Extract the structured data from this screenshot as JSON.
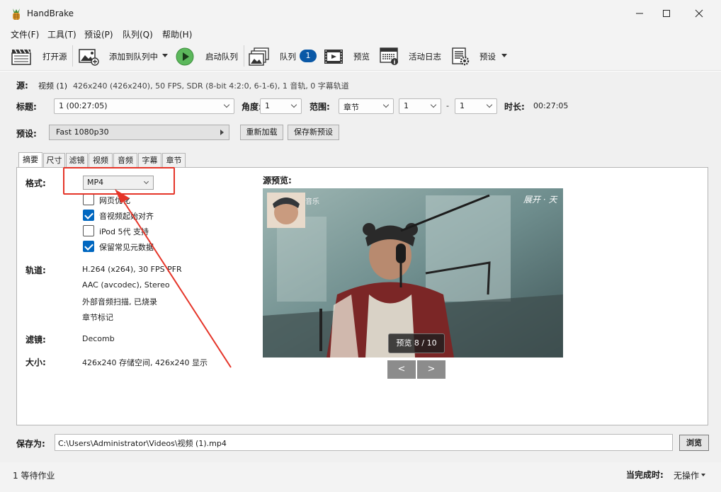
{
  "window": {
    "title": "HandBrake",
    "controls": {
      "minimize": "minimize-icon",
      "maximize": "maximize-icon",
      "close": "close-icon"
    }
  },
  "menu": [
    "文件(F)",
    "工具(T)",
    "预设(P)",
    "队列(Q)",
    "帮助(H)"
  ],
  "toolbar": {
    "open_source": "打开源",
    "add_to_queue": "添加到队列中",
    "start_queue": "启动队列",
    "queue": "队列",
    "queue_count": "1",
    "preview": "预览",
    "activity_log": "活动日志",
    "presets": "预设"
  },
  "source": {
    "label": "源:",
    "name": "视频 (1)",
    "info": "426x240 (426x240), 50 FPS, SDR (8-bit 4:2:0, 6-1-6), 1 音轨, 0 字幕轨道"
  },
  "title_row": {
    "title_label": "标题:",
    "title_value": "1  (00:27:05)",
    "angle_label": "角度:",
    "angle_value": "1",
    "range_label": "范围:",
    "range_type": "章节",
    "range_start": "1",
    "range_dash": "-",
    "range_end": "1",
    "duration_label": "时长:",
    "duration_value": "00:27:05"
  },
  "preset_row": {
    "label": "预设:",
    "value": "Fast 1080p30",
    "reload": "重新加载",
    "save_new": "保存新预设"
  },
  "tabs": [
    "摘要",
    "尺寸",
    "滤镜",
    "视频",
    "音频",
    "字幕",
    "章节"
  ],
  "summary": {
    "format_label": "格式:",
    "format_value": "MP4",
    "options": [
      {
        "label": "网页优化",
        "checked": false
      },
      {
        "label": "音视频起始对齐",
        "checked": true
      },
      {
        "label": "iPod 5代 支持",
        "checked": false
      },
      {
        "label": "保留常见元数据",
        "checked": true
      }
    ],
    "tracks_label": "轨道:",
    "tracks": [
      "H.264 (x264), 30 FPS PFR",
      "AAC (avcodec), Stereo",
      "外部音频扫描, 已烧录",
      "章节标记"
    ],
    "filters_label": "滤镜:",
    "filters_value": "Decomb",
    "size_label": "大小:",
    "size_value": "426x240 存储空间, 426x240 显示",
    "preview_label": "源预览:",
    "preview_counter": "预览 8 / 10",
    "prev_btn": "<",
    "next_btn": ">",
    "preview_overlay": {
      "text1": "音乐",
      "text2": "展开 · 天"
    }
  },
  "save": {
    "label": "保存为:",
    "path": "C:\\Users\\Administrator\\Videos\\视频 (1).mp4",
    "browse": "浏览"
  },
  "status": {
    "jobs": "1 等待作业",
    "when_done_label": "当完成时:",
    "when_done_value": "无操作"
  },
  "colors": {
    "accent": "#0a58a6",
    "annotation": "#e53529",
    "play_green": "#5cb85c"
  }
}
